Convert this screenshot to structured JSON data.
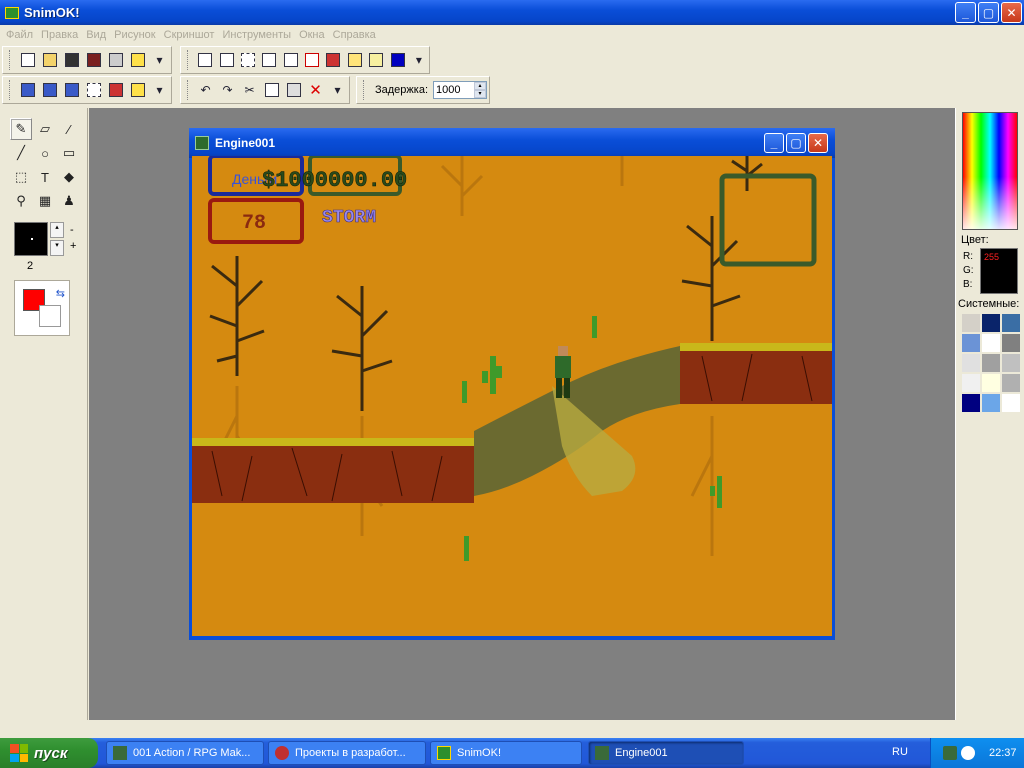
{
  "app": {
    "title": "SnimOK!"
  },
  "window_controls": {
    "minimize": "_",
    "maximize": "▢",
    "close": "✕"
  },
  "menu": [
    "Файл",
    "Правка",
    "Вид",
    "Рисунок",
    "Скриншот",
    "Инструменты",
    "Окна",
    "Справка"
  ],
  "toolbar": {
    "delay_label": "Задержка:",
    "delay_value": "1000"
  },
  "tools_panel": {
    "brush_size": "2",
    "minus": "-",
    "plus": "+",
    "tools": [
      {
        "name": "pencil-icon",
        "glyph": "✎"
      },
      {
        "name": "eraser-icon",
        "glyph": "▱"
      },
      {
        "name": "eyedropper-icon",
        "glyph": "⁄"
      },
      {
        "name": "line-icon",
        "glyph": "╱"
      },
      {
        "name": "ellipse-icon",
        "glyph": "○"
      },
      {
        "name": "rectangle-icon",
        "glyph": "▭"
      },
      {
        "name": "selection-icon",
        "glyph": "⬚"
      },
      {
        "name": "text-icon",
        "glyph": "T"
      },
      {
        "name": "fill-icon",
        "glyph": "◆"
      },
      {
        "name": "zoom-icon",
        "glyph": "⚲"
      },
      {
        "name": "spray-icon",
        "glyph": "▦"
      },
      {
        "name": "stamp-icon",
        "glyph": "♟"
      }
    ],
    "fg_color": "#ff0000",
    "bg_color": "#ffffff"
  },
  "color_panel": {
    "color_label": "Цвет:",
    "r_label": "R:",
    "g_label": "G:",
    "b_label": "B:",
    "r_value": "255",
    "system_label": "Системные:",
    "palette": [
      "#d4d0c8",
      "#0a246a",
      "#3a6ea5",
      "#6b93d6",
      "#ffffff",
      "#808080",
      "#e0e0e0",
      "#a0a0a0",
      "#c0c0c0",
      "#f0f0f0",
      "#ffffe1",
      "#b0b0b0",
      "#000080",
      "#6ba6e8",
      "#ffffff"
    ]
  },
  "game_window": {
    "title": "Engine001",
    "money": "$1000000.00",
    "ammo": "78",
    "weapon_name": "STORM",
    "money_label": "Деньги"
  },
  "taskbar": {
    "start_label": "пуск",
    "tasks": [
      {
        "label": "001 Action / RPG Mak...",
        "icon": "#3a6a3a"
      },
      {
        "label": "Проекты в разработ...",
        "icon": "#c03030"
      },
      {
        "label": "SnimOK!",
        "icon": "#2d8f2d"
      },
      {
        "label": "Engine001",
        "icon": "#3a6a3a"
      }
    ],
    "lang": "RU",
    "clock": "22:37"
  }
}
